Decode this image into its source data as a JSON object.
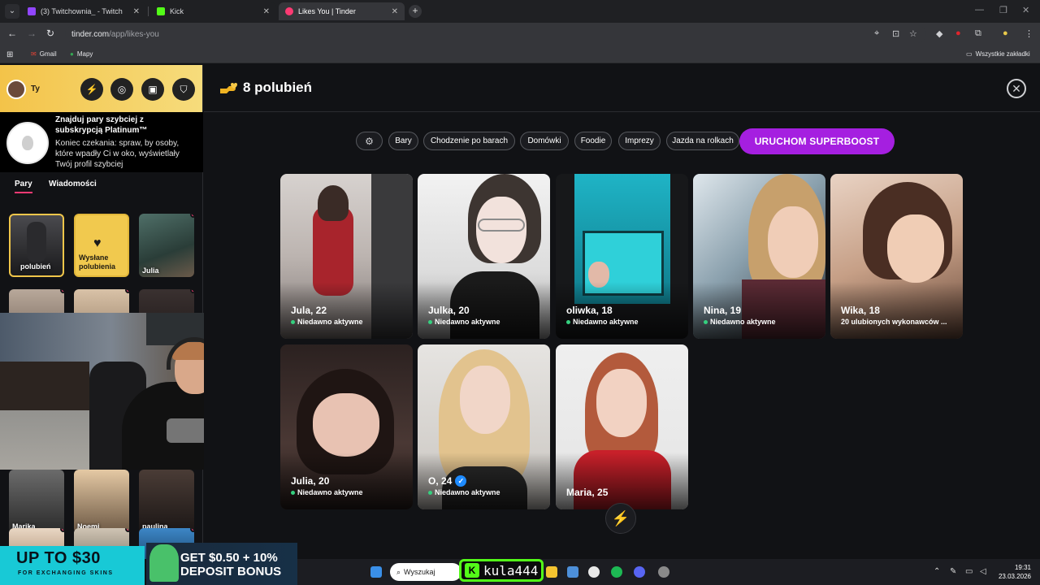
{
  "browser": {
    "tabs": [
      {
        "label": "(3) Twitchownia_ - Twitch",
        "color": "#9146ff",
        "active": false
      },
      {
        "label": "Kick",
        "color": "#53fc18",
        "active": false
      },
      {
        "label": "Likes You | Tinder",
        "color": "#fd3a73",
        "active": true
      }
    ],
    "url_domain": "tinder.com",
    "url_path": "/app/likes-you",
    "bookmarks": [
      "Gmail",
      "Mapy"
    ],
    "all_bookmarks": "Wszystkie zakładki"
  },
  "sidebar": {
    "user_label": "Ty",
    "promo_title": "Znajduj pary szybciej z subskrypcją Platinum™",
    "promo_desc": "Koniec czekania: spraw, by osoby, które wpadły Ci w oko, wyświetlały Twój profil szybciej",
    "tabs": [
      "Pary",
      "Wiadomości"
    ],
    "likes_tile": "polubień",
    "sent_likes_tile": "Wysłane polubienia",
    "matches": [
      "Julia",
      "Marika",
      "Noemi",
      "paulina"
    ]
  },
  "main": {
    "title": "8 polubień",
    "filters": [
      "Bary",
      "Chodzenie po barach",
      "Domówki",
      "Foodie",
      "Imprezy",
      "Jazda na rolkach"
    ],
    "superboost": "URUCHOM SUPERBOOST",
    "cards": [
      {
        "name": "Jula, 22",
        "status": "Niedawno aktywne"
      },
      {
        "name": "Julka, 20",
        "status": "Niedawno aktywne"
      },
      {
        "name": "oliwka, 18",
        "status": "Niedawno aktywne"
      },
      {
        "name": "Nina, 19",
        "status": "Niedawno aktywne"
      },
      {
        "name": "Wika, 18",
        "status": "20 ulubionych wykonawców ..."
      },
      {
        "name": "Julia, 20",
        "status": "Niedawno aktywne"
      },
      {
        "name": "O, 24",
        "status": "Niedawno aktywne",
        "verified": true
      },
      {
        "name": "Maria, 25",
        "status": ""
      }
    ]
  },
  "ads": {
    "left_line1": "UP TO $30",
    "left_line2": "FOR EXCHANGING SKINS",
    "right_line1": "GET $0.50 + 10%",
    "right_line2": "DEPOSIT BONUS"
  },
  "taskbar": {
    "search": "Wyszukaj",
    "kick_name": "kula444",
    "time": "19:31",
    "date": "23.03.2026"
  }
}
